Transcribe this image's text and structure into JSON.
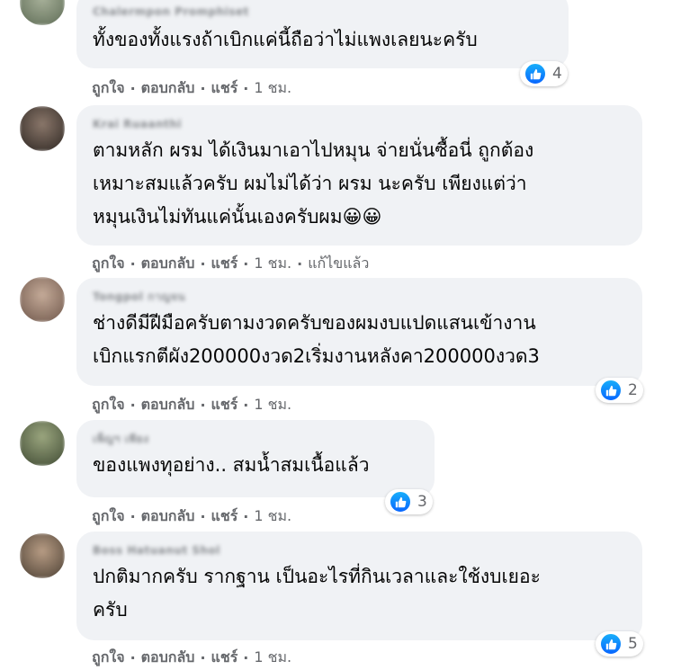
{
  "comments": [
    {
      "author": "Chalermpon Promphiset",
      "lines": [
        "ทั้งของทั้งแรงถ้าเบิกแค่นี้ถือว่าไม่แพงเลยนะครับ"
      ],
      "like": "ถูกใจ",
      "reply": "ตอบกลับ",
      "share": "แชร์",
      "time": "1 ชม.",
      "edited": "",
      "reaction_count": "4",
      "avatar_color": "#7a8a6e"
    },
    {
      "author": "Krai Ruaanthi",
      "lines": [
        "ตามหลัก ผรม ได้เงินมาเอาไปหมุน จ่ายนั่นซื้อนี่ ถูกต้อง",
        "เหมาะสมแล้วครับ ผมไม่ได้ว่า ผรม นะครับ เพียงแต่ว่า",
        "หมุนเงินไม่ทันแค่นั้นเองครับผม😀😀"
      ],
      "like": "ถูกใจ",
      "reply": "ตอบกลับ",
      "share": "แชร์",
      "time": "1 ชม.",
      "edited": "แก้ไขแล้ว",
      "reaction_count": "",
      "avatar_color": "#4a3f38"
    },
    {
      "author": "Tongpol กาญจน",
      "lines": [
        "ช่างดีมีฝีมือครับตามงวดครับของผมงบแปดแสนเข้างาน",
        "เบิกแรกตีผัง200000งวด2เริ่มงานหลังคา200000งวด3"
      ],
      "like": "ถูกใจ",
      "reply": "ตอบกลับ",
      "share": "แชร์",
      "time": "1 ชม.",
      "edited": "",
      "reaction_count": "2",
      "avatar_color": "#8c7466"
    },
    {
      "author": "เพ็ญฯ เพียง",
      "lines": [
        "ของแพงทุอย่าง.. สมน้ำสมเนื้อแล้ว"
      ],
      "like": "ถูกใจ",
      "reply": "ตอบกลับ",
      "share": "แชร์",
      "time": "1 ชม.",
      "edited": "",
      "reaction_count": "3",
      "avatar_color": "#5e6b4c"
    },
    {
      "author": "Boss Hatuanut Shol",
      "lines": [
        "ปกติมากครับ รากฐาน เป็นอะไรที่กินเวลาและใช้งบเยอะ",
        "ครับ"
      ],
      "like": "ถูกใจ",
      "reply": "ตอบกลับ",
      "share": "แชร์",
      "time": "1 ชม.",
      "edited": "",
      "reaction_count": "5",
      "avatar_color": "#6b5a48"
    }
  ],
  "icons": {
    "reaction": "thumbs-up-icon",
    "reaction_color": "#0866ff"
  }
}
